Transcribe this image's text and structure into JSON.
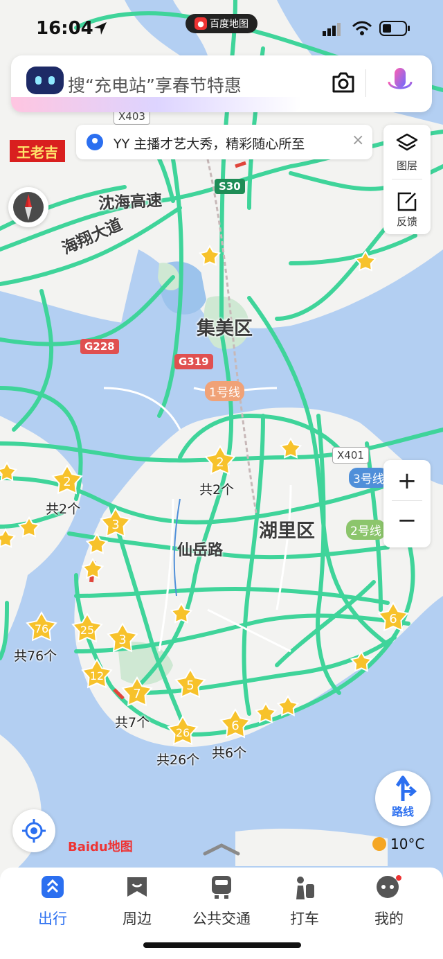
{
  "status": {
    "time": "16:04"
  },
  "app_pill": {
    "label": "百度地图"
  },
  "search": {
    "placeholder_text": "搜“充电站”享春节特惠"
  },
  "notice": {
    "text": "YY 主播才艺大秀，精彩随心所至",
    "close": "×"
  },
  "brand_logo": "王老吉",
  "right_panel": {
    "layers_label": "图层",
    "feedback_label": "反馈"
  },
  "zoom": {
    "plus": "+",
    "minus": "−"
  },
  "map": {
    "districts": [
      "集美区",
      "湖里区"
    ],
    "roads": [
      "沈海高速",
      "海翔大道",
      "仙岳路"
    ],
    "shields": [
      "X403",
      "S30",
      "G228",
      "G319",
      "X401"
    ],
    "metro_lines": [
      "1号线",
      "3号线",
      "2号线"
    ],
    "cluster_counts": [
      "2",
      "2",
      "3",
      "76",
      "25",
      "3",
      "12",
      "7",
      "5",
      "26",
      "6",
      "6"
    ],
    "cluster_labels": [
      "共2个",
      "共2个",
      "共76个",
      "共7个",
      "共26个",
      "共6个"
    ]
  },
  "route_button": {
    "label": "路线"
  },
  "baidu_logo": "Baidu地图",
  "weather": {
    "temp": "10°C"
  },
  "nav": [
    {
      "label": "出行",
      "active": true
    },
    {
      "label": "周边",
      "active": false
    },
    {
      "label": "公共交通",
      "active": false
    },
    {
      "label": "打车",
      "active": false
    },
    {
      "label": "我的",
      "active": false
    }
  ],
  "colors": {
    "road": "#3fd49a",
    "water": "#b3cff2",
    "land": "#f3f3f1",
    "park": "#cfe8d3",
    "accent": "#2b6ff0",
    "star": "#f7c22b"
  }
}
